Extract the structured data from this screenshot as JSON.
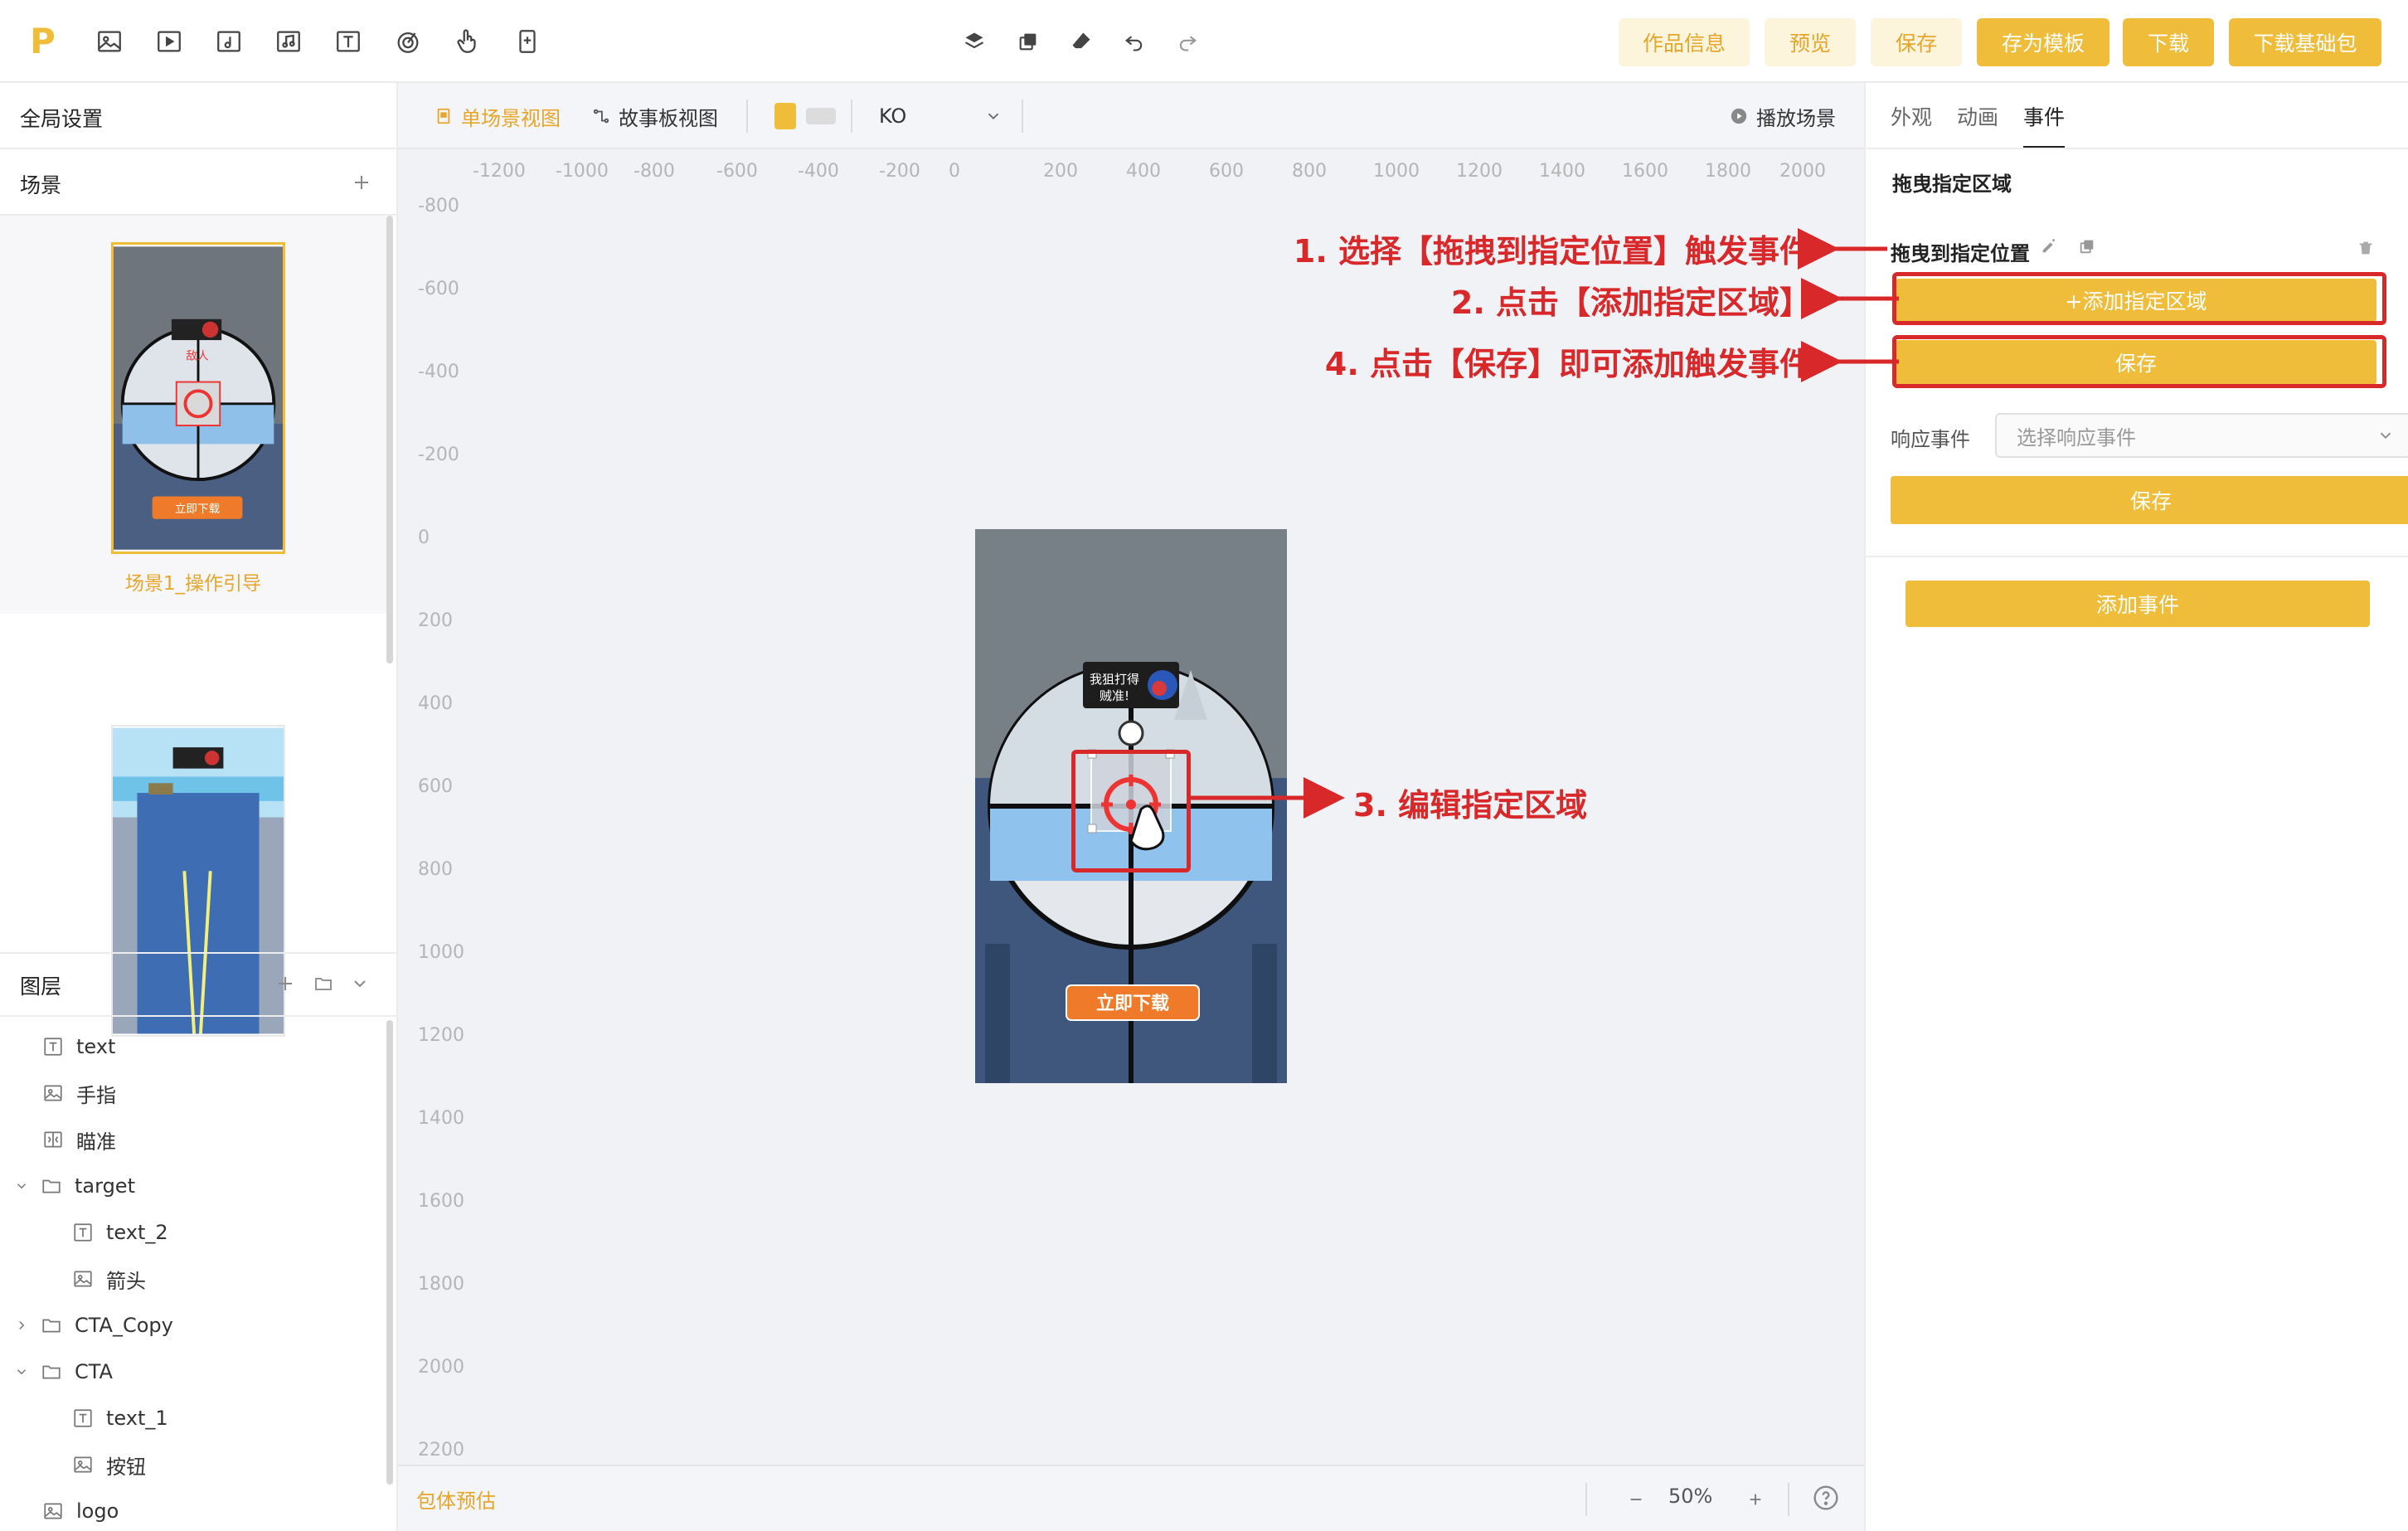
{
  "topbar": {
    "tools": [
      "image-tool-icon",
      "video-tool-icon",
      "audio-tool-icon",
      "music-tool-icon",
      "text-tool-icon",
      "spiral-tool-icon",
      "hand-tool-icon",
      "device-tool-icon"
    ],
    "buttons": {
      "work_info": "作品信息",
      "preview": "预览",
      "save": "保存",
      "save_template": "存为模板",
      "download": "下载",
      "download_base": "下载基础包"
    }
  },
  "left": {
    "global_settings": "全局设置",
    "scenes_title": "场景",
    "scene1_label": "场景1_操作引导",
    "scene_thumb_cta": "立即下载",
    "scene_thumb_tag": "敌人",
    "layers_title": "图层",
    "layers": [
      {
        "label": "text",
        "icon": "text-icon",
        "indent": 0
      },
      {
        "label": "手指",
        "icon": "image-icon",
        "indent": 0
      },
      {
        "label": "瞄准",
        "icon": "sequence-icon",
        "indent": 0
      },
      {
        "label": "target",
        "icon": "folder-icon",
        "indent": 0,
        "expand": "open"
      },
      {
        "label": "text_2",
        "icon": "text-icon",
        "indent": 1
      },
      {
        "label": "箭头",
        "icon": "image-icon",
        "indent": 1
      },
      {
        "label": "CTA_Copy",
        "icon": "folder-icon",
        "indent": 0,
        "expand": "closed"
      },
      {
        "label": "CTA",
        "icon": "folder-icon",
        "indent": 0,
        "expand": "open"
      },
      {
        "label": "text_1",
        "icon": "text-icon",
        "indent": 1
      },
      {
        "label": "按钮",
        "icon": "image-icon",
        "indent": 1
      },
      {
        "label": "logo",
        "icon": "image-icon",
        "indent": 0
      }
    ]
  },
  "center": {
    "tab_single": "单场景视图",
    "tab_story": "故事板视图",
    "lang": "KO",
    "play_scene": "播放场景",
    "ruler_top": [
      "-1200",
      "-1000",
      "-800",
      "-600",
      "-400",
      "-200",
      "0",
      "200",
      "400",
      "600",
      "800",
      "1000",
      "1200",
      "1400",
      "1600",
      "1800",
      "2000"
    ],
    "ruler_left": [
      "-800",
      "-600",
      "-400",
      "-200",
      "0",
      "200",
      "400",
      "600",
      "800",
      "1000",
      "1200",
      "1400",
      "1600",
      "1800",
      "2000",
      "2200"
    ],
    "phone_cta": "立即下载",
    "phone_banner_line1": "我狙打得",
    "phone_banner_line2": "贼准!",
    "package_estimate": "包体预估",
    "zoom": "50%",
    "colors": {
      "accent": "#f0bd3a",
      "gray_swatch": "#dcdcdc"
    }
  },
  "right": {
    "tab_appearance": "外观",
    "tab_animation": "动画",
    "tab_event": "事件",
    "section_title": "拖曳指定区域",
    "event_name": "拖曳到指定位置",
    "add_area_btn": "+添加指定区域",
    "save_btn_1": "保存",
    "response_label": "响应事件",
    "response_placeholder": "选择响应事件",
    "save_btn_2": "保存",
    "add_event_btn": "添加事件"
  },
  "annotations": {
    "a1": "1. 选择【拖拽到指定位置】触发事件",
    "a2": "2. 点击【添加指定区域】",
    "a3": "3. 编辑指定区域",
    "a4": "4. 点击【保存】即可添加触发事件",
    "color": "#d8282a"
  }
}
